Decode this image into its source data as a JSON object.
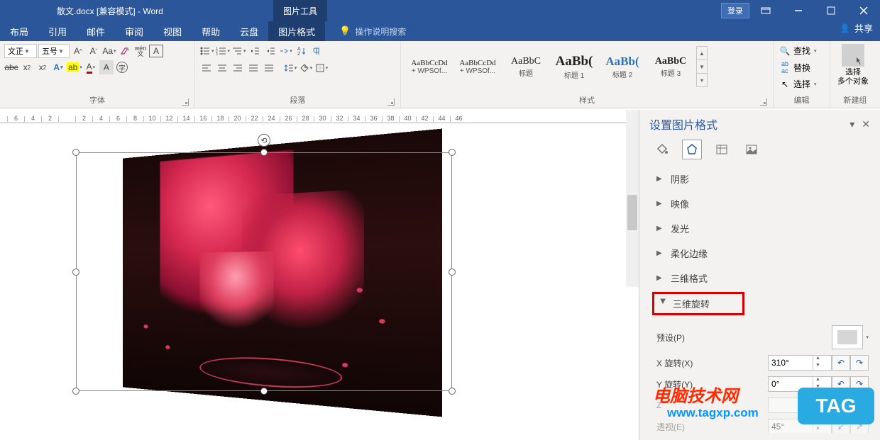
{
  "title": "散文.docx [兼容模式] - Word",
  "contextual_tab": "图片工具",
  "login": "登录",
  "tabs": {
    "layout": "布局",
    "references": "引用",
    "mailings": "邮件",
    "review": "审阅",
    "view": "视图",
    "help": "帮助",
    "cloud": "云盘",
    "picture_format": "图片格式"
  },
  "tell_me": "操作说明搜索",
  "share": "共享",
  "font": {
    "name": "文正",
    "size": "五号",
    "clear_label": "abc",
    "phonetic": "wén"
  },
  "group_labels": {
    "font": "字体",
    "paragraph": "段落",
    "styles": "样式",
    "editing": "编辑",
    "newgroup": "新建组"
  },
  "styles": [
    {
      "preview": "AaBbCcDd",
      "name": "+ WPSOf..."
    },
    {
      "preview": "AaBbCcDd",
      "name": "+ WPSOf..."
    },
    {
      "preview": "AaBbC",
      "name": "标题"
    },
    {
      "preview": "AaBb(",
      "name": "标题 1"
    },
    {
      "preview": "AaBb(",
      "name": "标题 2"
    },
    {
      "preview": "AaBbC",
      "name": "标题 3"
    }
  ],
  "editing": {
    "find": "查找",
    "replace": "替换",
    "select": "选择"
  },
  "newgroup": {
    "line1": "选择",
    "line2": "多个对象"
  },
  "ruler_nums": [
    "6",
    "4",
    "2",
    "",
    "2",
    "4",
    "6",
    "8",
    "10",
    "12",
    "14",
    "16",
    "18",
    "20",
    "22",
    "24",
    "26",
    "28",
    "30",
    "32",
    "34",
    "36",
    "38",
    "40",
    "42",
    "44",
    "46"
  ],
  "pane": {
    "title": "设置图片格式",
    "sections": {
      "shadow": "阴影",
      "reflection": "映像",
      "glow": "发光",
      "soft_edges": "柔化边缘",
      "3d_format": "三维格式",
      "3d_rotation": "三维旋转"
    },
    "preset_label": "预设(P)",
    "x_rotation": "X 旋转(X)",
    "y_rotation": "Y 旋转(Y)",
    "z_rotation": "Z",
    "perspective": "透视(E)",
    "x_value": "310°",
    "y_value": "0°",
    "z_value": "",
    "persp_value": "45°"
  },
  "watermark": {
    "line1": "电脑技术网",
    "line2": "www.tagxp.com",
    "tag": "TAG"
  }
}
